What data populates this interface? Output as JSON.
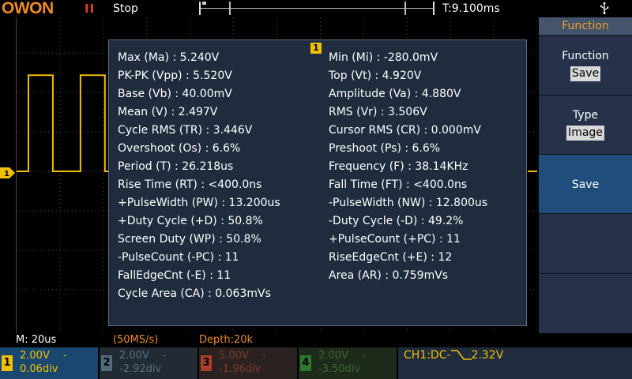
{
  "header": {
    "logo": "OWON",
    "run_indicator": "II",
    "run_state": "Stop",
    "trigger_time": "T:9.100ms"
  },
  "icons": {
    "usb": "usb-icon",
    "ch1_marker": "channel-1-marker-icon",
    "trigger_edge": "falling-edge-icon"
  },
  "colors": {
    "ch1": "#f0c000",
    "ch2": "#56708a",
    "ch3": "#7c3b28",
    "ch4": "#3d6b2c",
    "accent": "#f08a24"
  },
  "measurements": {
    "badge": "1",
    "left": [
      "Max (Ma) : 5.240V",
      "PK-PK (Vpp) : 5.520V",
      "Base (Vb) : 40.00mV",
      "Mean (V) : 2.497V",
      "Cycle RMS (TR) : 3.446V",
      "Overshoot (Os) : 6.6%",
      "Period (T) : 26.218us",
      "Rise Time (RT) : <400.0ns",
      "+PulseWidth (PW) : 13.200us",
      "+Duty Cycle (+D) : 50.8%",
      "Screen Duty (WP) : 50.8%",
      "-PulseCount (-PC) : 11",
      "FallEdgeCnt (-E) : 11",
      "Cycle Area (CA) : 0.063mVs"
    ],
    "right": [
      "Min (Mi) : -280.0mV",
      "Top (Vt) : 4.920V",
      "Amplitude (Va) : 4.880V",
      "RMS (Vr) : 3.506V",
      "Cursor RMS (CR) : 0.000mV",
      "Preshoot (Ps) : 6.6%",
      "Frequency (F) : 38.14KHz",
      "Fall Time (FT) : <400.0ns",
      "-PulseWidth (NW) : 12.800us",
      "-Duty Cycle (-D) : 49.2%",
      "+PulseCount (+PC) : 11",
      "RiseEdgeCnt (+E) : 12",
      "Area (AR) : 0.759mVs"
    ]
  },
  "menu": {
    "header": "Function",
    "function_label": "Function",
    "function_value": "Save",
    "type_label": "Type",
    "type_value": "Image",
    "save_label": "Save"
  },
  "status": {
    "timebase": "M: 20us",
    "sample_rate": "(50MS/s)",
    "depth": "Depth:20k"
  },
  "channels": [
    {
      "num": "1",
      "volts": "2.00V",
      "offset": "0.06div",
      "coupling": "-"
    },
    {
      "num": "2",
      "volts": "2.00V",
      "offset": "-2.92div",
      "coupling": "-"
    },
    {
      "num": "3",
      "volts": "5.00V",
      "offset": "-1.96div",
      "coupling": "-"
    },
    {
      "num": "4",
      "volts": "2.00V",
      "offset": "-3.50div",
      "coupling": "-"
    }
  ],
  "trigger": {
    "source": "CH1:DC-",
    "level": "2.32V"
  }
}
